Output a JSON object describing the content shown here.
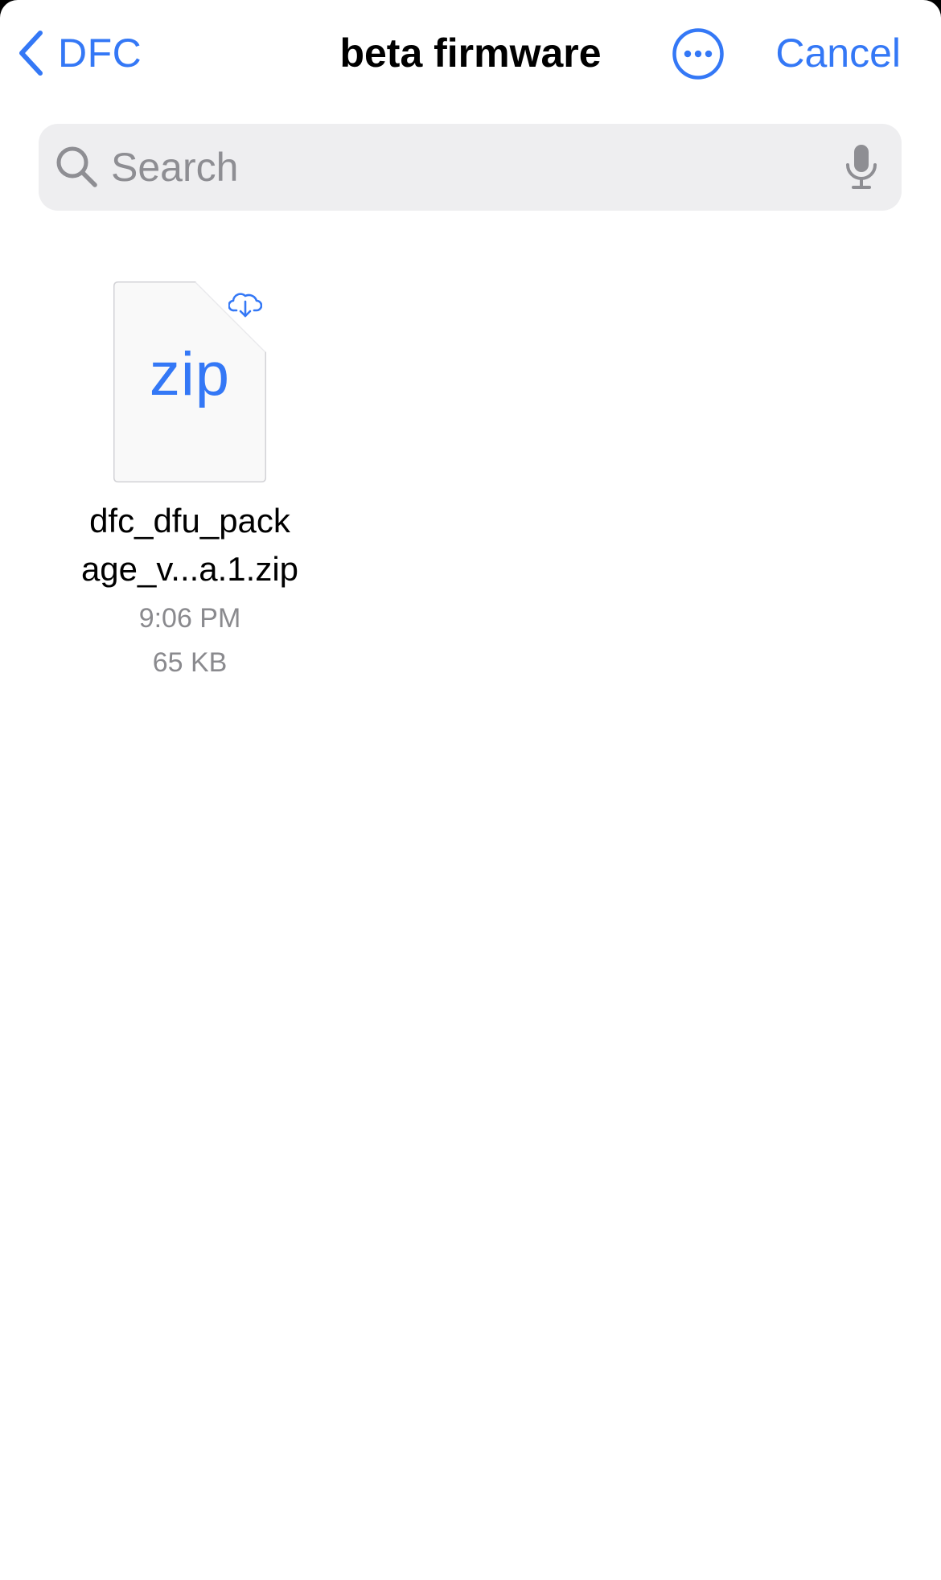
{
  "navbar": {
    "back_label": "DFC",
    "title": "beta firmware",
    "cancel_label": "Cancel",
    "more_icon": "ellipsis-circle-icon",
    "back_icon": "chevron-left-icon"
  },
  "search": {
    "placeholder": "Search",
    "value": "",
    "icon": "magnifying-glass-icon",
    "mic_icon": "microphone-icon"
  },
  "files": [
    {
      "name_line1": "dfc_dfu_pack",
      "name_line2": "age_v...a.1.zip",
      "extension": "zip",
      "modified": "9:06 PM",
      "size": "65 KB",
      "status_icon": "cloud-download-icon"
    }
  ],
  "colors": {
    "accent": "#3478f6",
    "background": "#ffffff",
    "search_field": "#eeeef0",
    "secondary_text": "#8a8a8e"
  }
}
